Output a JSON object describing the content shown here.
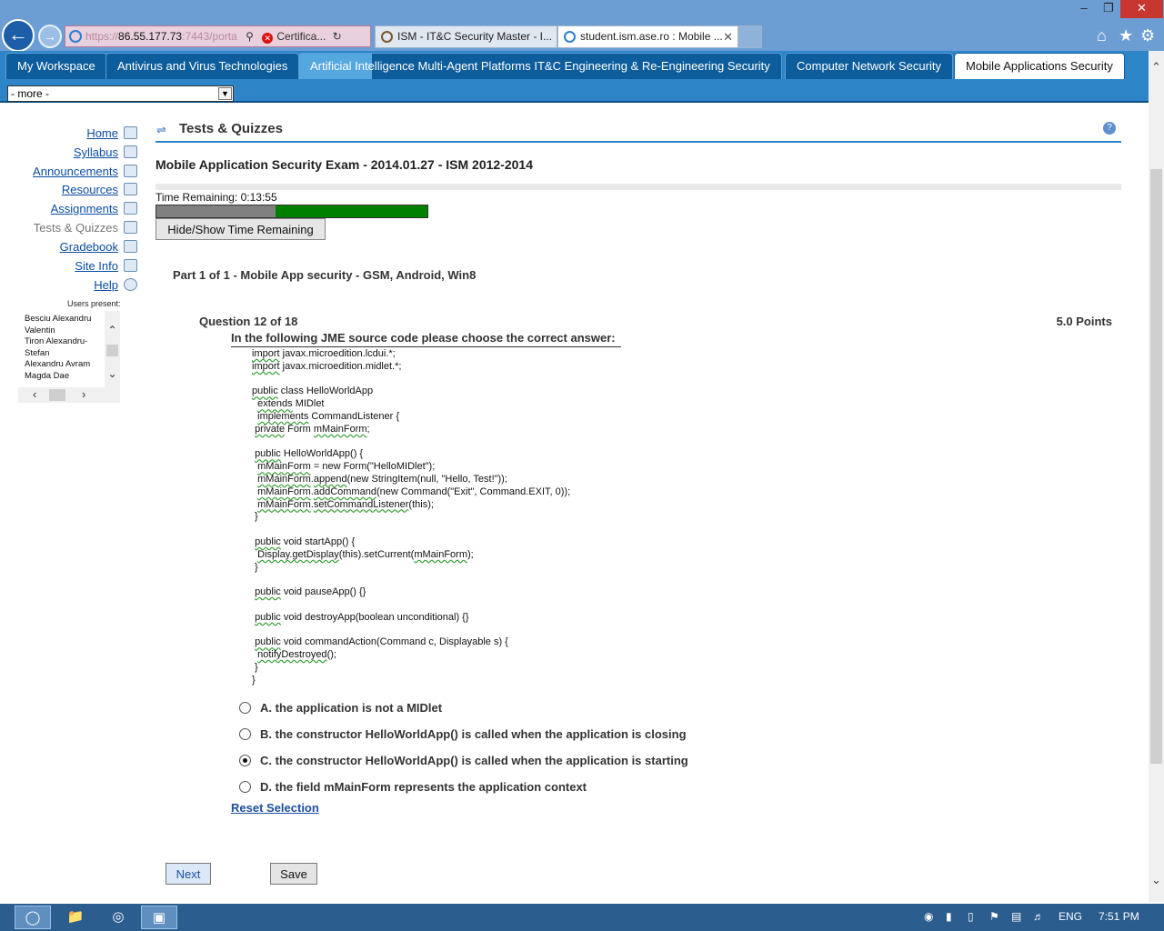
{
  "browser": {
    "address": {
      "scheme": "https://",
      "host": "86.55.177.73",
      "rest": ":7443/porta",
      "cert_label": "Certifica..."
    },
    "tabs": [
      {
        "label": "ISM - IT&C Security Master - I..."
      },
      {
        "label": "student.ism.ase.ro : Mobile ..."
      }
    ],
    "window_buttons": {
      "minimize": "‒",
      "restore": "❐",
      "close": "✕"
    },
    "toolbar_icons": [
      "home-icon",
      "favorites-icon",
      "settings-icon"
    ]
  },
  "site_tabs": [
    {
      "label": "My Workspace"
    },
    {
      "label": "Antivirus and Virus Technologies"
    },
    {
      "label": "Artificial Intelligence Multi-Agent Platforms IT&C Engineering & Re-Engineering Security"
    },
    {
      "label": "Computer Network Security"
    },
    {
      "label": "Mobile Applications Security"
    }
  ],
  "more_select": {
    "value": "- more -"
  },
  "menu": {
    "items": [
      {
        "label": "Home",
        "icon": "home-icon"
      },
      {
        "label": "Syllabus",
        "icon": "syllabus-icon"
      },
      {
        "label": "Announcements",
        "icon": "announcements-icon"
      },
      {
        "label": "Resources",
        "icon": "folder-icon"
      },
      {
        "label": "Assignments",
        "icon": "assignments-icon"
      },
      {
        "label": "Tests & Quizzes",
        "icon": "pencil-icon"
      },
      {
        "label": "Gradebook",
        "icon": "gradebook-icon"
      },
      {
        "label": "Site Info",
        "icon": "site-info-icon"
      },
      {
        "label": "Help",
        "icon": "help-icon"
      }
    ],
    "current": "Tests & Quizzes",
    "users_label": "Users present:",
    "users": [
      "Besciu Alexandru Valentin",
      "Tiron Alexandru-Stefan",
      "Alexandru Avram",
      "Magda Dae"
    ]
  },
  "main": {
    "tool_title": "Tests & Quizzes",
    "exam_title": "Mobile Application Security Exam - 2014.01.27 - ISM 2012-2014",
    "time_label": "Time Remaining:",
    "time_value": "0:13:55",
    "time_used_fraction": 0.44,
    "hide_show_label": "Hide/Show Time Remaining",
    "part_title": "Part 1 of 1 - Mobile App security - GSM, Android, Win8",
    "question_number": "Question 12 of 18",
    "points": "5.0 Points",
    "question_text": "In the following JME source code please choose the correct answer:",
    "code_lines": [
      "import javax.microedition.lcdui.*;",
      "import javax.microedition.midlet.*;",
      "",
      "public class HelloWorldApp",
      "  extends MIDlet",
      "  implements CommandListener {",
      " private Form mMainForm;",
      "",
      " public HelloWorldApp() {",
      "  mMainForm = new Form(\"HelloMIDlet\");",
      "  mMainForm.append(new StringItem(null, \"Hello, Test!\"));",
      "  mMainForm.addCommand(new Command(\"Exit\", Command.EXIT, 0));",
      "  mMainForm.setCommandListener(this);",
      " }",
      "",
      " public void startApp() {",
      "  Display.getDisplay(this).setCurrent(mMainForm);",
      " }",
      "",
      " public void pauseApp() {}",
      "",
      " public void destroyApp(boolean unconditional) {}",
      "",
      " public void commandAction(Command c, Displayable s) {",
      "  notifyDestroyed();",
      " }",
      "}"
    ],
    "answers": [
      {
        "label": "A. the application is not a MIDlet",
        "selected": false
      },
      {
        "label": "B. the constructor HelloWorldApp() is called when the application is closing",
        "selected": false
      },
      {
        "label": "C. the constructor HelloWorldApp() is called when the application is starting",
        "selected": true
      },
      {
        "label": "D. the field mMainForm represents the application context",
        "selected": false
      }
    ],
    "reset_label": "Reset Selection",
    "next_label": "Next",
    "save_label": "Save"
  },
  "taskbar": {
    "apps": [
      "internet-explorer-icon",
      "file-explorer-icon",
      "chrome-icon",
      "remote-desktop-icon"
    ],
    "language": "ENG",
    "clock": "7:51 PM"
  }
}
